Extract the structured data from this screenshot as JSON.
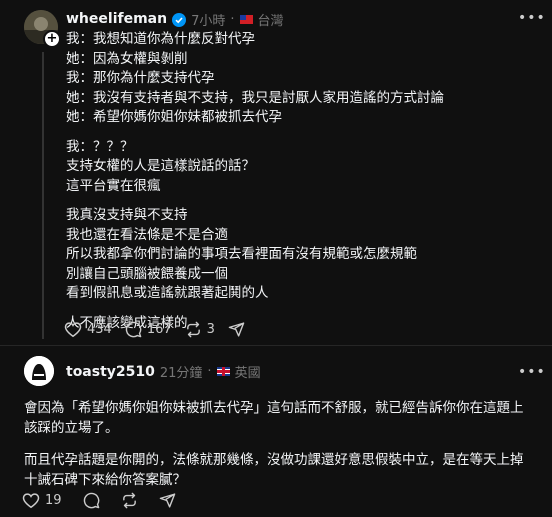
{
  "post": {
    "username": "wheelifeman",
    "time": "7小時",
    "location": "台灣",
    "lines_group1": [
      "我：我想知道你為什麼反對代孕",
      "她：因為女權與剝削",
      "我：那你為什麼支持代孕",
      "她：我沒有支持者與不支持，我只是討厭人家用造謠的方式討論",
      "她：希望你媽你姐你妹都被抓去代孕"
    ],
    "lines_group2": [
      "我：？？？",
      "支持女權的人是這樣說話的話？",
      "這平台實在很瘋"
    ],
    "lines_group3": [
      "我真沒支持與不支持",
      "我也還在看法條是不是合適",
      "所以我都拿你們討論的事項去看裡面有沒有規範或怎麼規範",
      "別讓自己頭腦被餵養成一個",
      "看到假訊息或造謠就跟著起鬨的人"
    ],
    "lines_group4": [
      "人不應該變成這樣的"
    ],
    "likes": "434",
    "comments": "167",
    "reposts": "3"
  },
  "reply": {
    "username": "toasty2510",
    "time": "21分鐘",
    "location": "英國",
    "paragraph1": "會因為「希望你媽你姐你妹被抓去代孕」這句話而不舒服，就已經告訴你你在這題上該踩的立場了。",
    "paragraph2": "而且代孕話題是你開的，法條就那幾條，沒做功課還好意思假裝中立，是在等天上掉十誡石碑下來給你答案膩？",
    "likes": "19"
  },
  "colors": {
    "background": "#101010",
    "text": "#f3f5f7",
    "muted": "#777777",
    "verified": "#0095f6"
  },
  "icons": [
    "heart-icon",
    "comment-icon",
    "repost-icon",
    "share-icon",
    "verified-badge-icon",
    "more-icon",
    "plus-icon"
  ]
}
